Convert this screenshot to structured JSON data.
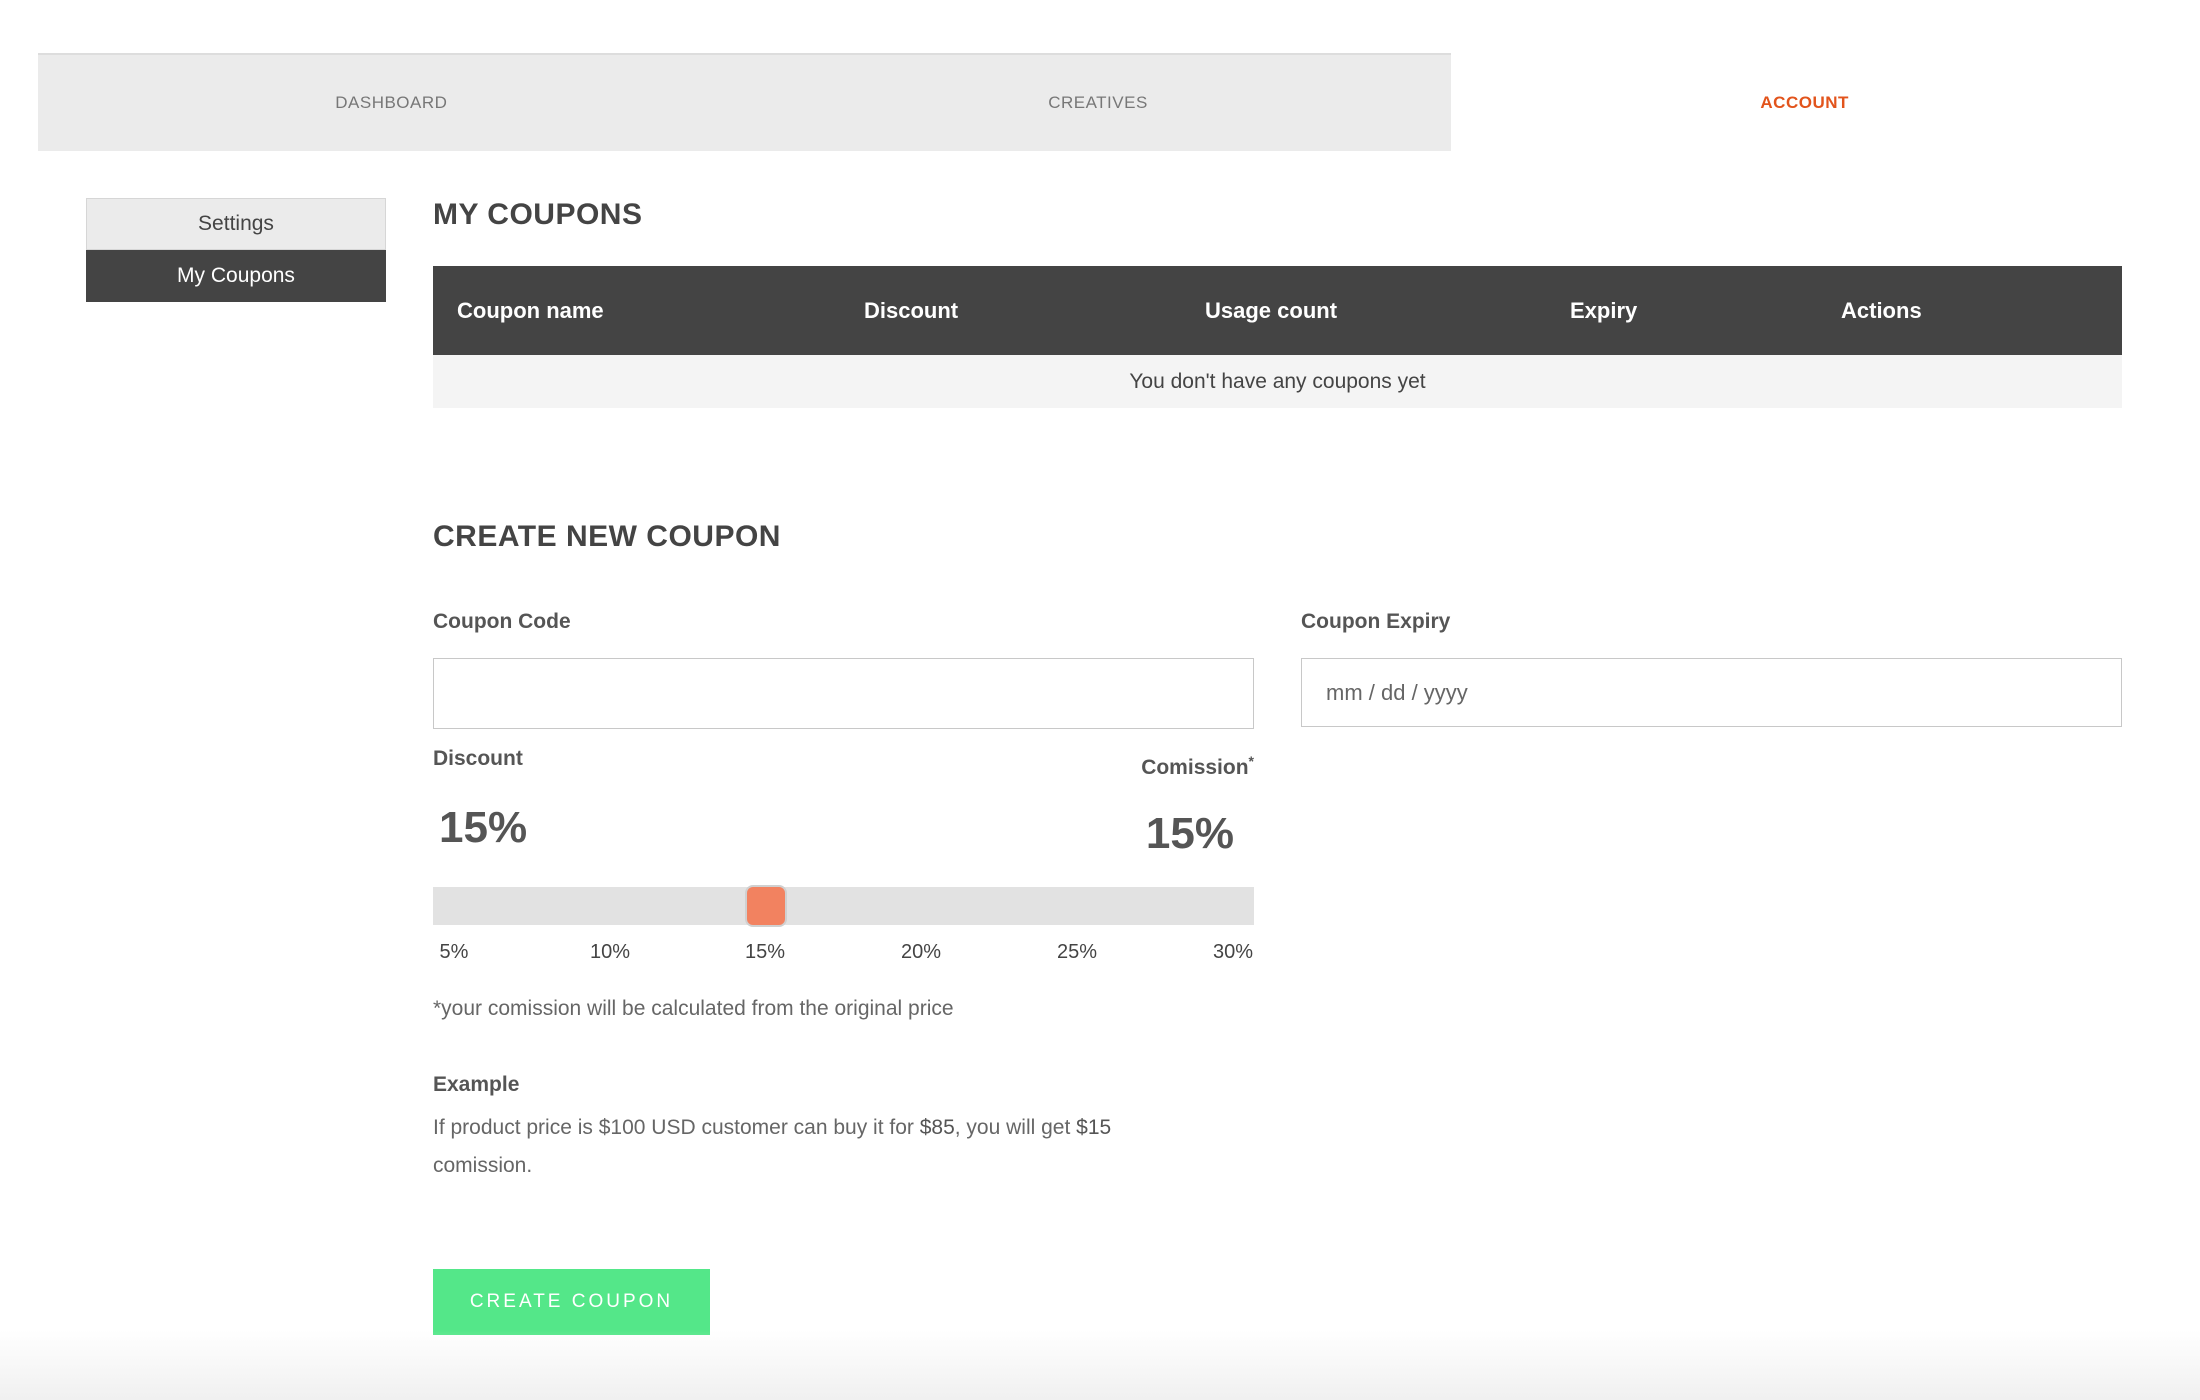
{
  "topnav": {
    "tabs": [
      {
        "label": "DASHBOARD"
      },
      {
        "label": "CREATIVES"
      },
      {
        "label": "ACCOUNT"
      }
    ],
    "active_tab": "ACCOUNT",
    "active_color": "#e2541c"
  },
  "sidebar": {
    "items": [
      {
        "label": "Settings"
      },
      {
        "label": "My Coupons"
      }
    ],
    "active_item": "My Coupons"
  },
  "coupons": {
    "title": "MY COUPONS",
    "columns": [
      "Coupon name",
      "Discount",
      "Usage count",
      "Expiry",
      "Actions"
    ],
    "empty_message": "You don't have any coupons yet"
  },
  "create": {
    "title": "CREATE NEW COUPON",
    "code_label": "Coupon Code",
    "code_value": "",
    "expiry_label": "Coupon Expiry",
    "expiry_placeholder": "mm / dd / yyyy",
    "discount_label": "Discount",
    "commission_label": "Comission",
    "commission_marker": "*",
    "discount_value": "15%",
    "commission_value": "15%",
    "slider": {
      "min": 5,
      "max": 30,
      "value": 15,
      "ticks": [
        "5%",
        "10%",
        "15%",
        "20%",
        "25%",
        "30%"
      ],
      "thumb_color": "#f28260"
    },
    "note": "*your comission will be calculated from the original price",
    "example_title": "Example",
    "example": {
      "part1": "If product price is $100 USD customer can buy it for ",
      "price": "$85",
      "part2": ", you will get ",
      "commission": "$15",
      "part3": " comission."
    },
    "button_label": "CREATE COUPON",
    "button_color": "#54e789"
  }
}
